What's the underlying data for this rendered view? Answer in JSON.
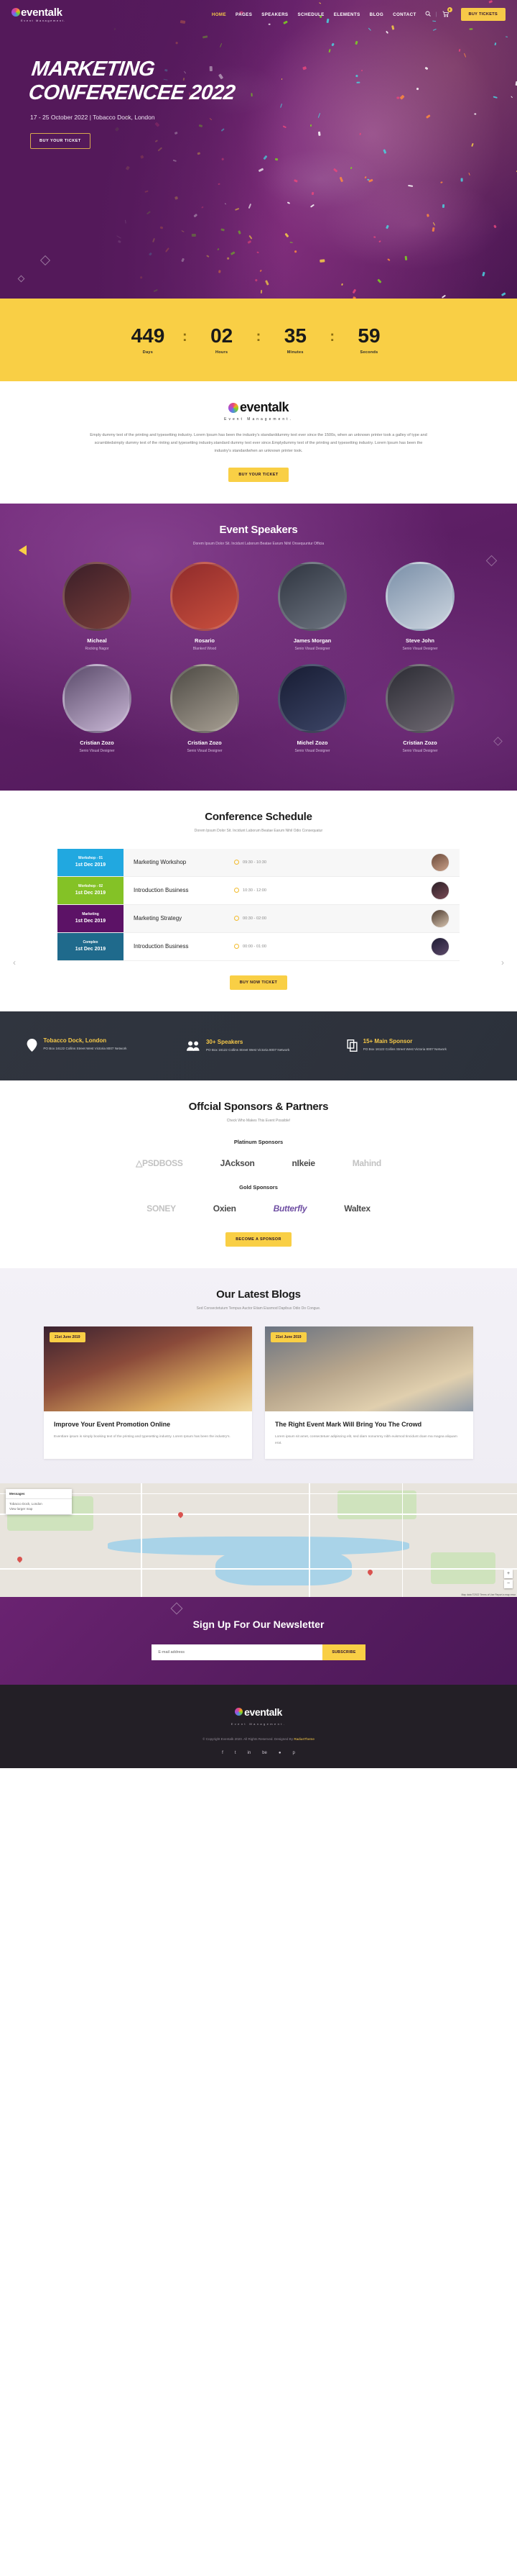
{
  "header": {
    "logo": {
      "main": "eventalk",
      "sub": "Event Management."
    },
    "nav": [
      {
        "label": "HOME",
        "active": true
      },
      {
        "label": "PAGES",
        "active": false
      },
      {
        "label": "SPEAKERS",
        "active": false
      },
      {
        "label": "SCHEDULE",
        "active": false
      },
      {
        "label": "ELEMENTS",
        "active": false
      },
      {
        "label": "BLOG",
        "active": false
      },
      {
        "label": "CONTACT",
        "active": false
      }
    ],
    "search_icon": "search-icon",
    "cart_icon": "cart-icon",
    "cart_count": "0",
    "buy_tickets_label": "BUY TICKETS"
  },
  "hero": {
    "title_line1": "MARKETING",
    "title_line2": "CONFERENCEE 2022",
    "subtitle": "17 - 25 October 2022 | Tobacco Dock, London",
    "button_label": "BUY YOUR TICKET"
  },
  "countdown": {
    "items": [
      {
        "value": "449",
        "label": "Days"
      },
      {
        "value": "02",
        "label": "Hours"
      },
      {
        "value": "35",
        "label": "Minutes"
      },
      {
        "value": "59",
        "label": "Seconds"
      }
    ],
    "separator": ":"
  },
  "about": {
    "logo_main": "eventalk",
    "logo_sub": "Event Management.",
    "paragraph": "Emply dummy text of the printing and typesetting industry. Lorem Ipsum has been the industry's standarddummy text ever since the 1500s, when an unknown printer took a galley of type and scrambledsimply dummy text of the rinting and typesetting industry.standard dummy text ever since.Emplydummy text of the printing and typesetting industry. Lorem Ipsum has been the industry's standardwhen an unknown printer took.",
    "button_label": "BUY YOUR TICKET"
  },
  "speakers": {
    "title": "Event Speakers",
    "subtitle": "Dorem Ipsum Dolor Sit. Incidunt Laborum Beatae Earum Nihil Onsequuntur Officia",
    "items": [
      {
        "name": "Micheal",
        "role": "Rocking Nagor",
        "tone1": "#3a1e28",
        "tone2": "#7a3f3a"
      },
      {
        "name": "Rosario",
        "role": "Blanked Wood",
        "tone1": "#8f2b2b",
        "tone2": "#c94f3d"
      },
      {
        "name": "James Morgan",
        "role": "Senio Visual Designer",
        "tone1": "#2f3540",
        "tone2": "#6d7480"
      },
      {
        "name": "Steve John",
        "role": "Senio Visual Designer",
        "tone1": "#7a8fa8",
        "tone2": "#cdd6e0"
      },
      {
        "name": "Cristian Zozo",
        "role": "Senio Visual Designer",
        "tone1": "#5a4a6a",
        "tone2": "#c9b8d6"
      },
      {
        "name": "Cristian Zozo",
        "role": "Senio Visual Designer",
        "tone1": "#4d4a44",
        "tone2": "#a79f93"
      },
      {
        "name": "Michel Zozo",
        "role": "Senio Visual Designer",
        "tone1": "#171c33",
        "tone2": "#3c4566"
      },
      {
        "name": "Cristian Zozo",
        "role": "Senio Visual Designer",
        "tone1": "#2b2b33",
        "tone2": "#6f6a73"
      }
    ]
  },
  "schedule": {
    "title": "Conference Schedule",
    "subtitle": "Dorem Ipsum Dolor Sit. Incidunt Laborum Beatae Earum Nihil Odio Consequatur",
    "prev_icon": "chevron-left-icon",
    "next_icon": "chevron-right-icon",
    "rows": [
      {
        "tag": "Workshop - 01",
        "date": "1st Dec 2019",
        "color": "#21a8e0",
        "name": "Marketing Workshop",
        "time": "09:30 - 10:30",
        "avatar1": "#6b4a3a",
        "avatar2": "#c9a089"
      },
      {
        "tag": "Workshop - 02",
        "date": "1st Dec 2019",
        "color": "#84c226",
        "name": "Introduction Business",
        "time": "10:30 - 12:00",
        "avatar1": "#2a1f26",
        "avatar2": "#7a4a55"
      },
      {
        "tag": "Marketing",
        "date": "1st Dec 2019",
        "color": "#5c1266",
        "name": "Marketing Strategy",
        "time": "00:30 - 02:00",
        "avatar1": "#4c3a2e",
        "avatar2": "#d7c4b0"
      },
      {
        "tag": "Complex",
        "date": "1st Dec 2019",
        "color": "#1f6a8c",
        "name": "Introduction Business",
        "time": "00:00 - 01:00",
        "avatar1": "#1d1b33",
        "avatar2": "#5d4a6a"
      }
    ],
    "button_label": "BUY NOW TICKET"
  },
  "infobar": {
    "items": [
      {
        "icon": "map-pin-icon",
        "glyph": "•",
        "title": "Tobacco Dock, London",
        "desc": "PO Box 16122 Collins Street West Victoria 8007 Network"
      },
      {
        "icon": "people-icon",
        "glyph": "•",
        "title": "30+ Speakers",
        "desc": "PO Box 16122 Collins Street West Victoria 8007 Network"
      },
      {
        "icon": "copy-icon",
        "glyph": "•",
        "title": "15+ Main Sponsor",
        "desc": "PO Box 16122 Collins Street West Victoria 8007 Network"
      }
    ]
  },
  "sponsors": {
    "title": "Offcial Sponsors & Partners",
    "subtitle": "Check Who Makes This Event Possible!",
    "platinum_title": "Platinum Sponsors",
    "platinum": [
      {
        "label": "△PSDBOSS",
        "style": "gray"
      },
      {
        "label": "JAckson",
        "style": "dark"
      },
      {
        "label": "nIkeie",
        "style": "dark"
      },
      {
        "label": "Mahind",
        "style": "gray"
      }
    ],
    "gold_title": "Gold Sponsors",
    "gold": [
      {
        "label": "SONEY",
        "style": "gray"
      },
      {
        "label": "Oxien",
        "style": "dark"
      },
      {
        "label": "Butterfly",
        "style": "it"
      },
      {
        "label": "Waltex",
        "style": "dark"
      }
    ],
    "button_label": "BECOME A SPONSOR"
  },
  "blogs": {
    "title": "Our Latest Blogs",
    "subtitle": "Sed Consectetuium Tempus Auctor Etiam Eiusmod Dapibus Odio Do Congue.",
    "cards": [
      {
        "date": "21st June 2019",
        "title": "Improve Your Event Promotion Online",
        "text": "Eventlare ipsum is simply booking text of the printing and typesetting industry. Lorem Ipsum has been the industry's."
      },
      {
        "date": "21st June 2019",
        "title": "The Right Event Mark Will Bring You The Crowd",
        "text": "Lorem ipsum sit amet, consectetuer adipiscing elit, sed diam nonummy nibh euismod tincidunt doan ma magna aliquam erat."
      }
    ]
  },
  "map": {
    "card_title": "Messages",
    "card_body": "Tobacco Dock, London\nView larger map",
    "zoom_in": "+",
    "zoom_out": "−",
    "attribution": "Map data ©2022  Terms of Use  Report a map error"
  },
  "newsletter": {
    "title": "Sign Up For Our Newsletter",
    "input_value": "E-mail address",
    "input_placeholder": "E-mail address",
    "button_label": "SUBSCRIBE"
  },
  "footer": {
    "logo_main": "eventalk",
    "logo_sub": "Event Management.",
    "copyright": "© Copyright Eventalk 2020. All Rights Reserved. Designed By ",
    "copyright_brand": "RadiusTheme",
    "social": [
      {
        "name": "facebook-icon",
        "glyph": "f"
      },
      {
        "name": "twitter-icon",
        "glyph": "t"
      },
      {
        "name": "linkedin-icon",
        "glyph": "in"
      },
      {
        "name": "behance-icon",
        "glyph": "be"
      },
      {
        "name": "dribbble-icon",
        "glyph": "●"
      },
      {
        "name": "pinterest-icon",
        "glyph": "p"
      }
    ]
  }
}
